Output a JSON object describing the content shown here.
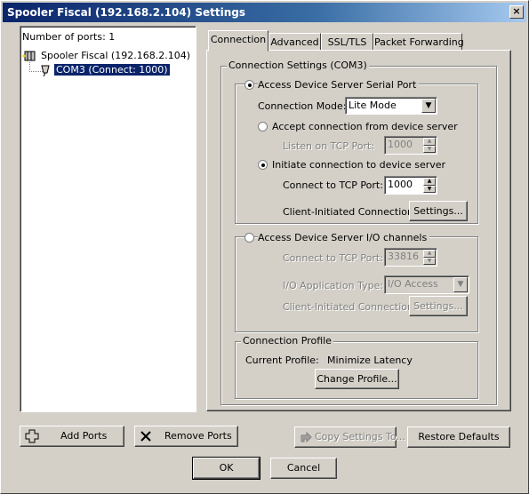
{
  "window": {
    "title": "Spooler Fiscal (192.168.2.104) Settings",
    "close_label": "×"
  },
  "left": {
    "ports_label": "Number of ports: 1",
    "tree": {
      "root": "Spooler Fiscal (192.168.2.104)",
      "child": "COM3 (Connect: 1000)"
    }
  },
  "tabs": [
    "Connection",
    "Advanced",
    "SSL/TLS",
    "Packet Forwarding"
  ],
  "connection": {
    "group_title": "Connection Settings (COM3)",
    "serial": {
      "radio_label": "Access Device Server Serial Port",
      "mode_label": "Connection Mode:",
      "mode_value": "Lite Mode",
      "accept_label": "Accept connection from device server",
      "listen_label": "Listen on TCP Port:",
      "listen_value": "1000",
      "initiate_label": "Initiate connection to device server",
      "connect_label": "Connect to TCP Port:",
      "connect_value": "1000",
      "client_label": "Client-Initiated Connection",
      "settings_label": "Settings..."
    },
    "io": {
      "radio_label": "Access Device Server I/O channels",
      "connect_label": "Connect to TCP Port:",
      "connect_value": "33816",
      "apptype_label": "I/O Application Type:",
      "apptype_value": "I/O Access",
      "client_label": "Client-Initiated Connection",
      "settings_label": "Settings..."
    },
    "profile": {
      "group_title": "Connection Profile",
      "current_label": "Current Profile:",
      "current_value": "Minimize Latency",
      "change_label": "Change  Profile..."
    }
  },
  "bottom": {
    "add_ports": "Add Ports",
    "remove_ports": "Remove Ports",
    "copy_settings": "Copy Settings To...",
    "restore_defaults": "Restore Defaults",
    "ok": "OK",
    "cancel": "Cancel"
  }
}
